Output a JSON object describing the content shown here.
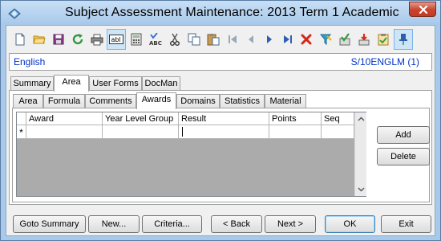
{
  "window": {
    "title": "Subject Assessment Maintenance:  2013 Term 1 Academic"
  },
  "toolbar": {
    "buttons": [
      {
        "name": "new-document-icon"
      },
      {
        "name": "open-folder-icon"
      },
      {
        "name": "save-icon"
      },
      {
        "name": "refresh-icon"
      },
      {
        "name": "print-icon"
      },
      {
        "name": "text-field-icon"
      },
      {
        "name": "calculator-icon"
      },
      {
        "name": "spell-check-icon"
      },
      {
        "name": "cut-icon"
      },
      {
        "name": "copy-icon"
      },
      {
        "name": "paste-icon"
      },
      {
        "name": "first-record-icon"
      },
      {
        "name": "previous-record-icon"
      },
      {
        "name": "next-record-icon"
      },
      {
        "name": "last-record-icon"
      },
      {
        "name": "delete-icon"
      },
      {
        "name": "filter-icon"
      },
      {
        "name": "approve-icon"
      },
      {
        "name": "export-icon"
      },
      {
        "name": "clipboard-check-icon"
      },
      {
        "name": "pin-icon"
      }
    ]
  },
  "info": {
    "left": "English",
    "right": "S/10ENGLM (1)"
  },
  "tabs_top": [
    "Summary",
    "Area",
    "User Forms",
    "DocMan"
  ],
  "tabs_top_selected": "Area",
  "tabs_sub": [
    "Area",
    "Formula",
    "Comments",
    "Awards",
    "Domains",
    "Statistics",
    "Material"
  ],
  "tabs_sub_selected": "Awards",
  "grid": {
    "columns": [
      "Award",
      "Year Level Group",
      "Result",
      "Points",
      "Seq"
    ],
    "new_row_marker": "*"
  },
  "side_buttons": {
    "add": "Add",
    "delete": "Delete"
  },
  "footer": {
    "goto_summary": "Goto Summary",
    "new": "New...",
    "criteria": "Criteria...",
    "back": "< Back",
    "next": "Next >",
    "ok": "OK",
    "exit": "Exit"
  },
  "colors": {
    "info_text": "#0033cc",
    "window_frame": "#a9c9ea",
    "close_button": "#c8432e"
  }
}
